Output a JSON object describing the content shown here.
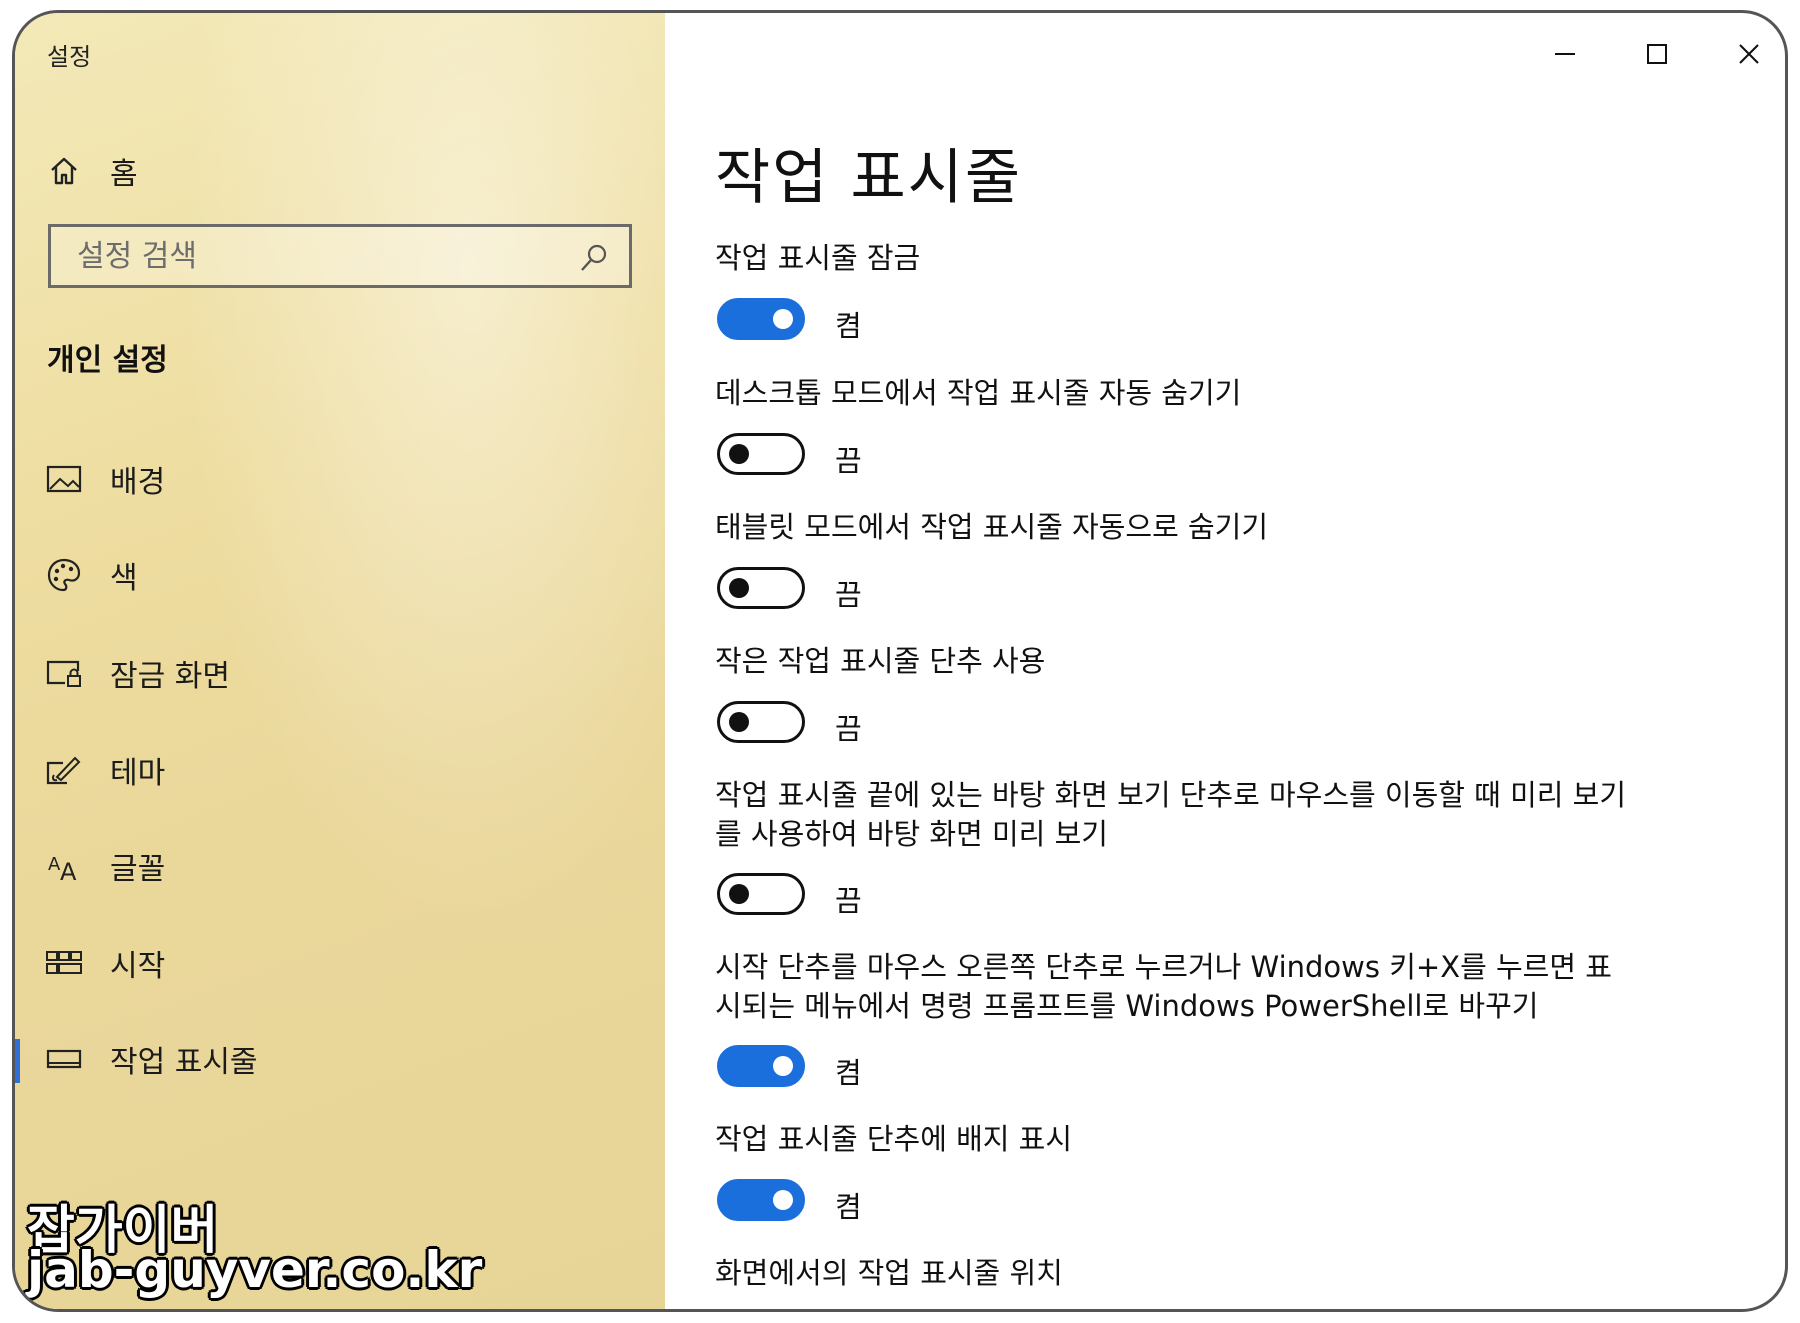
{
  "window": {
    "title": "설정",
    "controls": {
      "minimize": "minimize-icon",
      "maximize": "maximize-icon",
      "close": "close-icon"
    }
  },
  "sidebar": {
    "home_label": "홈",
    "search_placeholder": "설정 검색",
    "section_title": "개인 설정",
    "items": [
      {
        "label": "배경",
        "icon": "picture-icon"
      },
      {
        "label": "색",
        "icon": "palette-icon"
      },
      {
        "label": "잠금 화면",
        "icon": "lock-screen-icon"
      },
      {
        "label": "테마",
        "icon": "theme-brush-icon"
      },
      {
        "label": "글꼴",
        "icon": "font-icon"
      },
      {
        "label": "시작",
        "icon": "start-tiles-icon"
      },
      {
        "label": "작업 표시줄",
        "icon": "taskbar-icon",
        "active": true
      }
    ],
    "accent_color": "#2f6fd6"
  },
  "watermark": {
    "line1": "잡가이버",
    "line2": "jab-guyver.co.kr"
  },
  "main": {
    "title": "작업 표시줄",
    "settings": [
      {
        "label": "작업 표시줄 잠금",
        "on": true,
        "state": "켬"
      },
      {
        "label": "데스크톱 모드에서 작업 표시줄 자동 숨기기",
        "on": false,
        "state": "끔"
      },
      {
        "label": "태블릿 모드에서 작업 표시줄 자동으로 숨기기",
        "on": false,
        "state": "끔"
      },
      {
        "label": "작은 작업 표시줄 단추 사용",
        "on": false,
        "state": "끔"
      },
      {
        "label": "작업 표시줄 끝에 있는 바탕 화면 보기 단추로 마우스를 이동할 때 미리 보기를 사용하여 바탕 화면 미리 보기",
        "on": false,
        "state": "끔"
      },
      {
        "label": "시작 단추를 마우스 오른쪽 단추로 누르거나 Windows 키+X를 누르면 표시되는 메뉴에서 명령 프롬프트를 Windows PowerShell로 바꾸기",
        "on": true,
        "state": "켬"
      },
      {
        "label": "작업 표시줄 단추에 배지 표시",
        "on": true,
        "state": "켬"
      }
    ],
    "position_label": "화면에서의 작업 표시줄 위치",
    "toggle_on_color": "#1a6fdc"
  }
}
